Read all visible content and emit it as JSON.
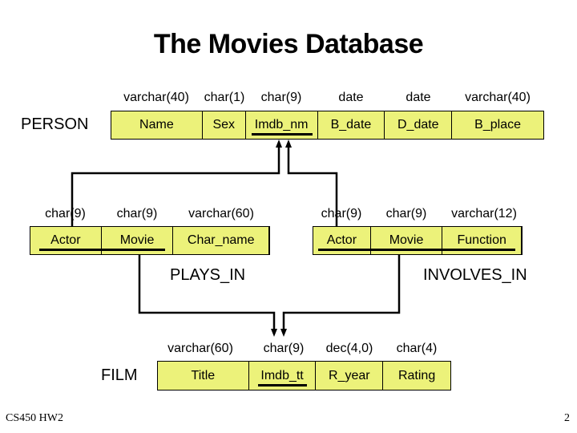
{
  "title": "The Movies Database",
  "fill_color": "#ecf27a",
  "tables": {
    "person": {
      "name": "PERSON",
      "columns": [
        {
          "name": "Name",
          "type": "varchar(40)",
          "key": false
        },
        {
          "name": "Sex",
          "type": "char(1)",
          "key": false
        },
        {
          "name": "Imdb_nm",
          "type": "char(9)",
          "key": true
        },
        {
          "name": "B_date",
          "type": "date",
          "key": false
        },
        {
          "name": "D_date",
          "type": "date",
          "key": false
        },
        {
          "name": "B_place",
          "type": "varchar(40)",
          "key": false
        }
      ]
    },
    "plays_in": {
      "name": "PLAYS_IN",
      "columns": [
        {
          "name": "Actor",
          "type": "char(9)",
          "key": true
        },
        {
          "name": "Movie",
          "type": "char(9)",
          "key": true
        },
        {
          "name": "Char_name",
          "type": "varchar(60)",
          "key": false
        }
      ]
    },
    "involves_in": {
      "name": "INVOLVES_IN",
      "columns": [
        {
          "name": "Actor",
          "type": "char(9)",
          "key": true
        },
        {
          "name": "Movie",
          "type": "char(9)",
          "key": true
        },
        {
          "name": "Function",
          "type": "varchar(12)",
          "key": true
        }
      ]
    },
    "film": {
      "name": "FILM",
      "columns": [
        {
          "name": "Title",
          "type": "varchar(60)",
          "key": false
        },
        {
          "name": "Imdb_tt",
          "type": "char(9)",
          "key": true
        },
        {
          "name": "R_year",
          "type": "dec(4,0)",
          "key": false
        },
        {
          "name": "Rating",
          "type": "char(4)",
          "key": false
        }
      ]
    }
  },
  "relationships": [
    {
      "from": "PLAYS_IN.Actor",
      "to": "PERSON.Imdb_nm"
    },
    {
      "from": "INVOLVES_IN.Actor",
      "to": "PERSON.Imdb_nm"
    },
    {
      "from": "PLAYS_IN.Movie",
      "to": "FILM.Imdb_tt"
    },
    {
      "from": "INVOLVES_IN.Movie",
      "to": "FILM.Imdb_tt"
    }
  ],
  "footer": {
    "course": "CS450 HW2",
    "page_number": "2"
  }
}
